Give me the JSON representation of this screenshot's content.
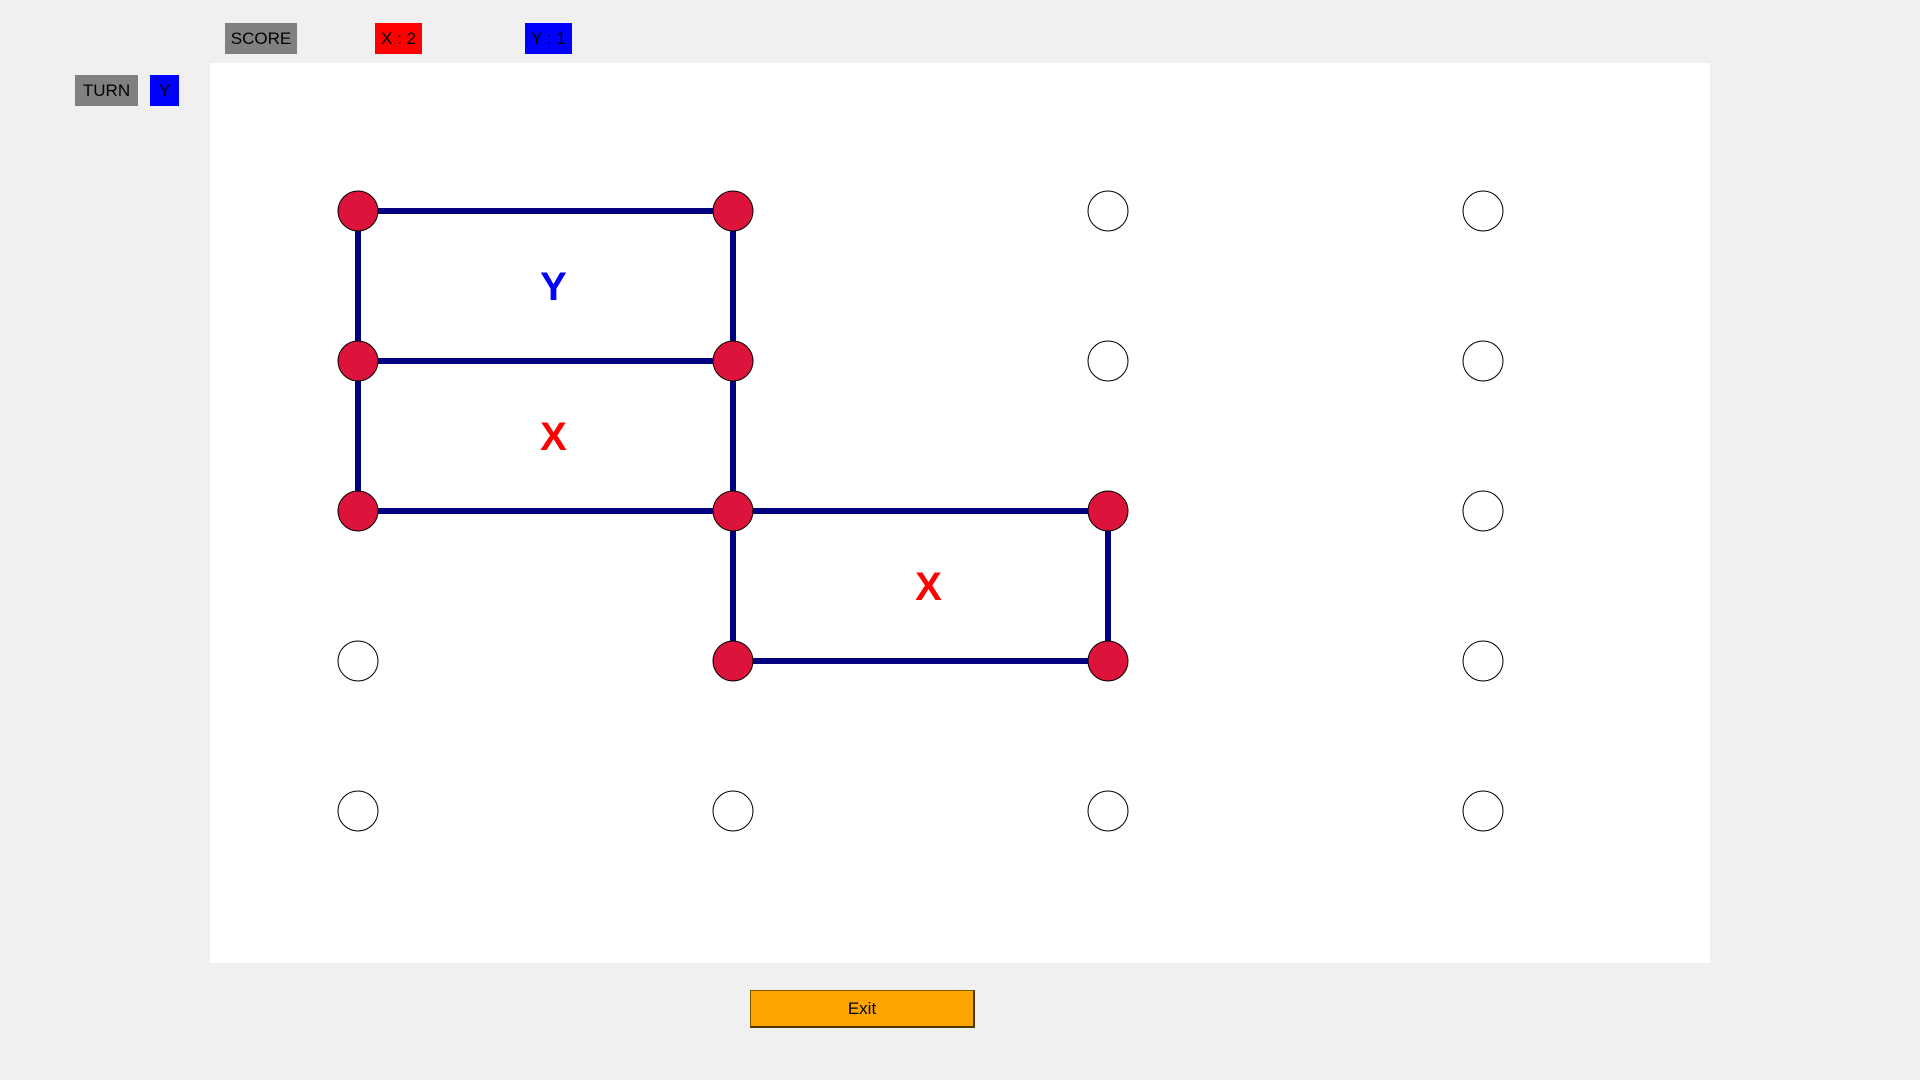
{
  "header": {
    "score_label": "SCORE",
    "score_x": "X : 2",
    "score_y": "Y : 1",
    "turn_label": "TURN",
    "turn_value": "Y"
  },
  "colors": {
    "window_bg": "#f0f0f0",
    "board_bg": "#ffffff",
    "label_gray": "#808080",
    "player_x": "#ff0000",
    "player_y": "#0000ff",
    "dot_selected": "#dc143c",
    "dot_empty": "#ffffff",
    "line": "#000080",
    "exit_button": "#ffa500"
  },
  "board": {
    "rows": 5,
    "cols": 4,
    "selected_dots": [
      [
        0,
        0
      ],
      [
        0,
        1
      ],
      [
        1,
        0
      ],
      [
        1,
        1
      ],
      [
        2,
        0
      ],
      [
        2,
        1
      ],
      [
        2,
        2
      ],
      [
        3,
        1
      ],
      [
        3,
        2
      ]
    ],
    "lines": [
      [
        [
          0,
          0
        ],
        [
          0,
          1
        ]
      ],
      [
        [
          1,
          0
        ],
        [
          1,
          1
        ]
      ],
      [
        [
          2,
          0
        ],
        [
          2,
          1
        ]
      ],
      [
        [
          2,
          1
        ],
        [
          2,
          2
        ]
      ],
      [
        [
          3,
          1
        ],
        [
          3,
          2
        ]
      ],
      [
        [
          0,
          0
        ],
        [
          1,
          0
        ]
      ],
      [
        [
          1,
          0
        ],
        [
          2,
          0
        ]
      ],
      [
        [
          0,
          1
        ],
        [
          1,
          1
        ]
      ],
      [
        [
          1,
          1
        ],
        [
          2,
          1
        ]
      ],
      [
        [
          2,
          1
        ],
        [
          3,
          1
        ]
      ],
      [
        [
          2,
          2
        ],
        [
          3,
          2
        ]
      ]
    ],
    "boxes": [
      {
        "row": 0,
        "col": 0,
        "owner": "Y"
      },
      {
        "row": 1,
        "col": 0,
        "owner": "X"
      },
      {
        "row": 2,
        "col": 1,
        "owner": "X"
      }
    ]
  },
  "footer": {
    "exit_label": "Exit"
  }
}
